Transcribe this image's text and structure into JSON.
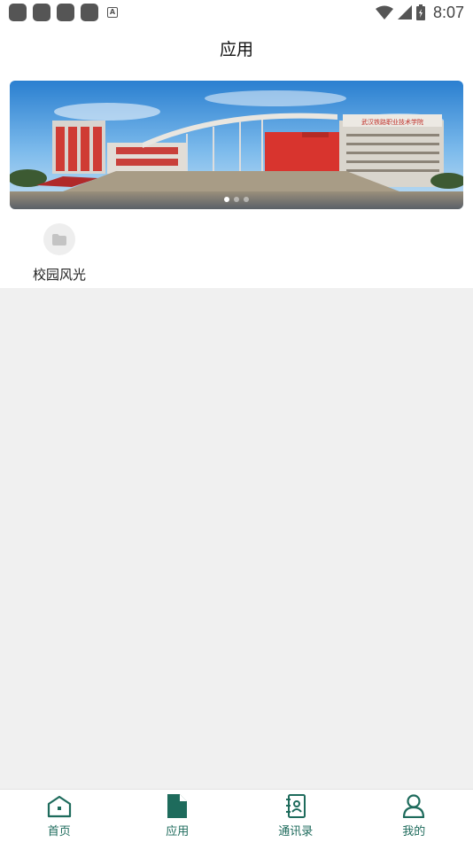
{
  "status_bar": {
    "time": "8:07",
    "icons": [
      "notification-icon",
      "notification-icon",
      "notification-icon",
      "notification-icon",
      "a-icon",
      "wifi-icon",
      "signal-icon",
      "battery-icon"
    ]
  },
  "header": {
    "title": "应用"
  },
  "banner": {
    "image": "campus-building-photo",
    "sign_text": "武汉铁路职业技术学院",
    "slides": 3,
    "active_slide": 1
  },
  "apps": [
    {
      "label": "校园风光",
      "icon": "folder-icon"
    }
  ],
  "bottom_nav": {
    "items": [
      {
        "label": "首页",
        "icon": "home-icon"
      },
      {
        "label": "应用",
        "icon": "document-icon",
        "active": true
      },
      {
        "label": "通讯录",
        "icon": "contacts-icon"
      },
      {
        "label": "我的",
        "icon": "person-icon"
      }
    ]
  },
  "colors": {
    "accent": "#1e6b5c",
    "background": "#f0f0f0",
    "surface": "#ffffff"
  }
}
